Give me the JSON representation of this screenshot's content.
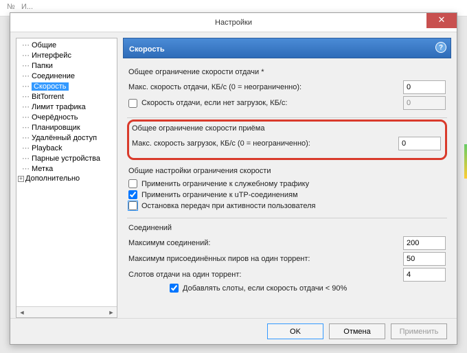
{
  "window": {
    "title": "Настройки"
  },
  "sidebar": {
    "items": [
      {
        "label": "Общие"
      },
      {
        "label": "Интерфейс"
      },
      {
        "label": "Папки"
      },
      {
        "label": "Соединение"
      },
      {
        "label": "Скорость",
        "selected": true
      },
      {
        "label": "BitTorrent"
      },
      {
        "label": "Лимит трафика"
      },
      {
        "label": "Очерёдность"
      },
      {
        "label": "Планировщик"
      },
      {
        "label": "Удалённый доступ"
      },
      {
        "label": "Playback"
      },
      {
        "label": "Парные устройства"
      },
      {
        "label": "Метка"
      },
      {
        "label": "Дополнительно",
        "expandable": true
      }
    ]
  },
  "header": {
    "title": "Скорость"
  },
  "upload": {
    "group_title": "Общее ограничение скорости отдачи *",
    "max_label": "Макс. скорость отдачи, КБ/с (0 = неограниченно):",
    "max_value": "0",
    "alt_label": "Скорость отдачи, если нет загрузок, КБ/с:",
    "alt_value": "0"
  },
  "download": {
    "group_title": "Общее ограничение скорости приёма",
    "max_label": "Макс. скорость загрузок, КБ/с (0 = неограниченно):",
    "max_value": "0"
  },
  "global": {
    "group_title": "Общие настройки ограничения скорости",
    "overhead_label": "Применить ограничение к служебному трафику",
    "utp_label": "Применить ограничение к uTP-соединениям",
    "stop_label": "Остановка передач при активности пользователя"
  },
  "conn": {
    "group_title": "Соединений",
    "max_label": "Максимум соединений:",
    "max_value": "200",
    "peers_label": "Максимум присоединённых пиров на один торрент:",
    "peers_value": "50",
    "slots_label": "Слотов отдачи на один торрент:",
    "slots_value": "4",
    "extra_label": "Добавлять слоты, если скорость отдачи < 90%"
  },
  "buttons": {
    "ok": "OK",
    "cancel": "Отмена",
    "apply": "Применить"
  }
}
